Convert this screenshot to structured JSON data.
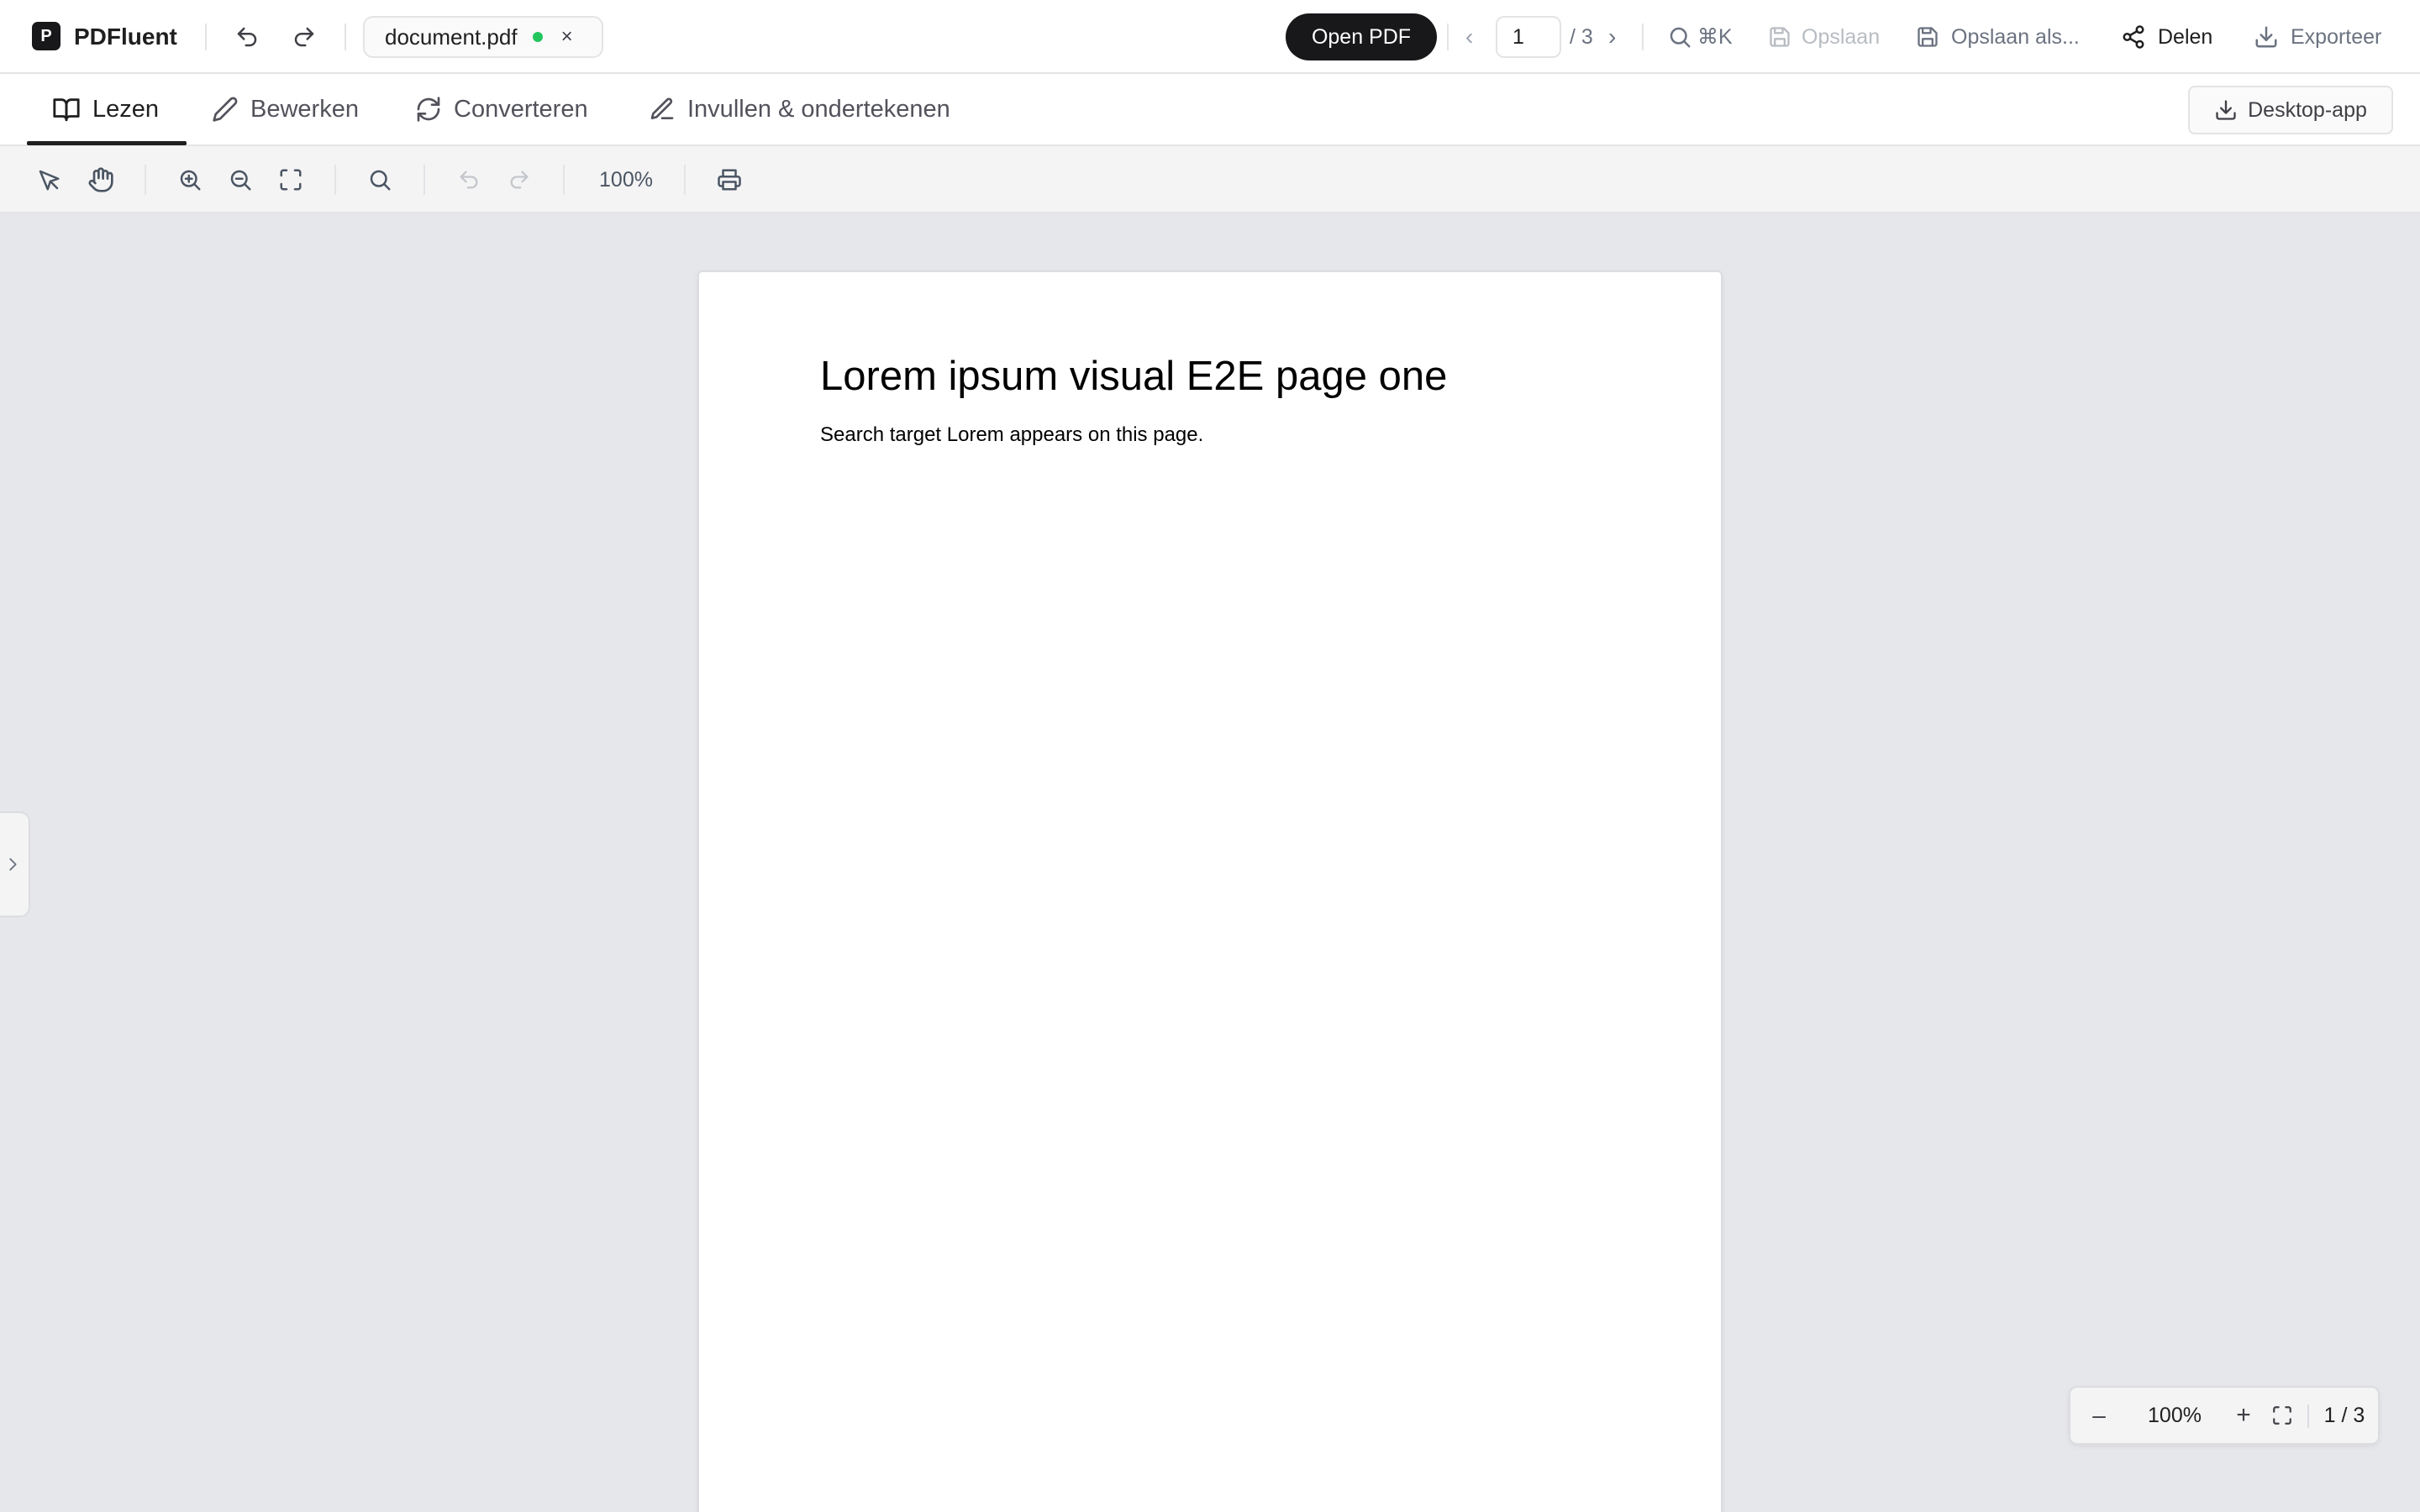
{
  "app": {
    "logo_letter": "P",
    "name": "PDFluent"
  },
  "topbar": {
    "file_name": "document.pdf",
    "file_status": "saved",
    "close_symbol": "×",
    "open_pdf_label": "Open PDF",
    "page_current": "1",
    "page_total": "/ 3",
    "prev_symbol": "‹",
    "next_symbol": "›",
    "search_shortcut": "⌘K",
    "save_label": "Opslaan",
    "save_as_label": "Opslaan als...",
    "share_label": "Delen",
    "export_label": "Exporteer"
  },
  "tabs": [
    {
      "label": "Lezen",
      "icon": "book-icon",
      "active": true
    },
    {
      "label": "Bewerken",
      "icon": "pencil-icon",
      "active": false
    },
    {
      "label": "Converteren",
      "icon": "refresh-icon",
      "active": false
    },
    {
      "label": "Invullen & ondertekenen",
      "icon": "pen-line-icon",
      "active": false
    }
  ],
  "desktop_app_label": "Desktop-app",
  "toolbar": {
    "zoom": "100%",
    "tools": [
      "select-pointer-icon",
      "hand-pan-icon",
      "zoom-in-icon",
      "zoom-out-icon",
      "fit-page-icon",
      "search-icon",
      "undo-icon",
      "redo-icon",
      "print-icon"
    ]
  },
  "document": {
    "heading": "Lorem ipsum visual E2E page one",
    "body": "Search target Lorem appears on this page."
  },
  "zoom_widget": {
    "minus": "–",
    "zoom": "100%",
    "plus": "+",
    "page_indicator": "1 / 3"
  },
  "colors": {
    "accent_dark": "#18181b",
    "status_green": "#22c55e",
    "canvas_bg": "#e6e7eb"
  }
}
